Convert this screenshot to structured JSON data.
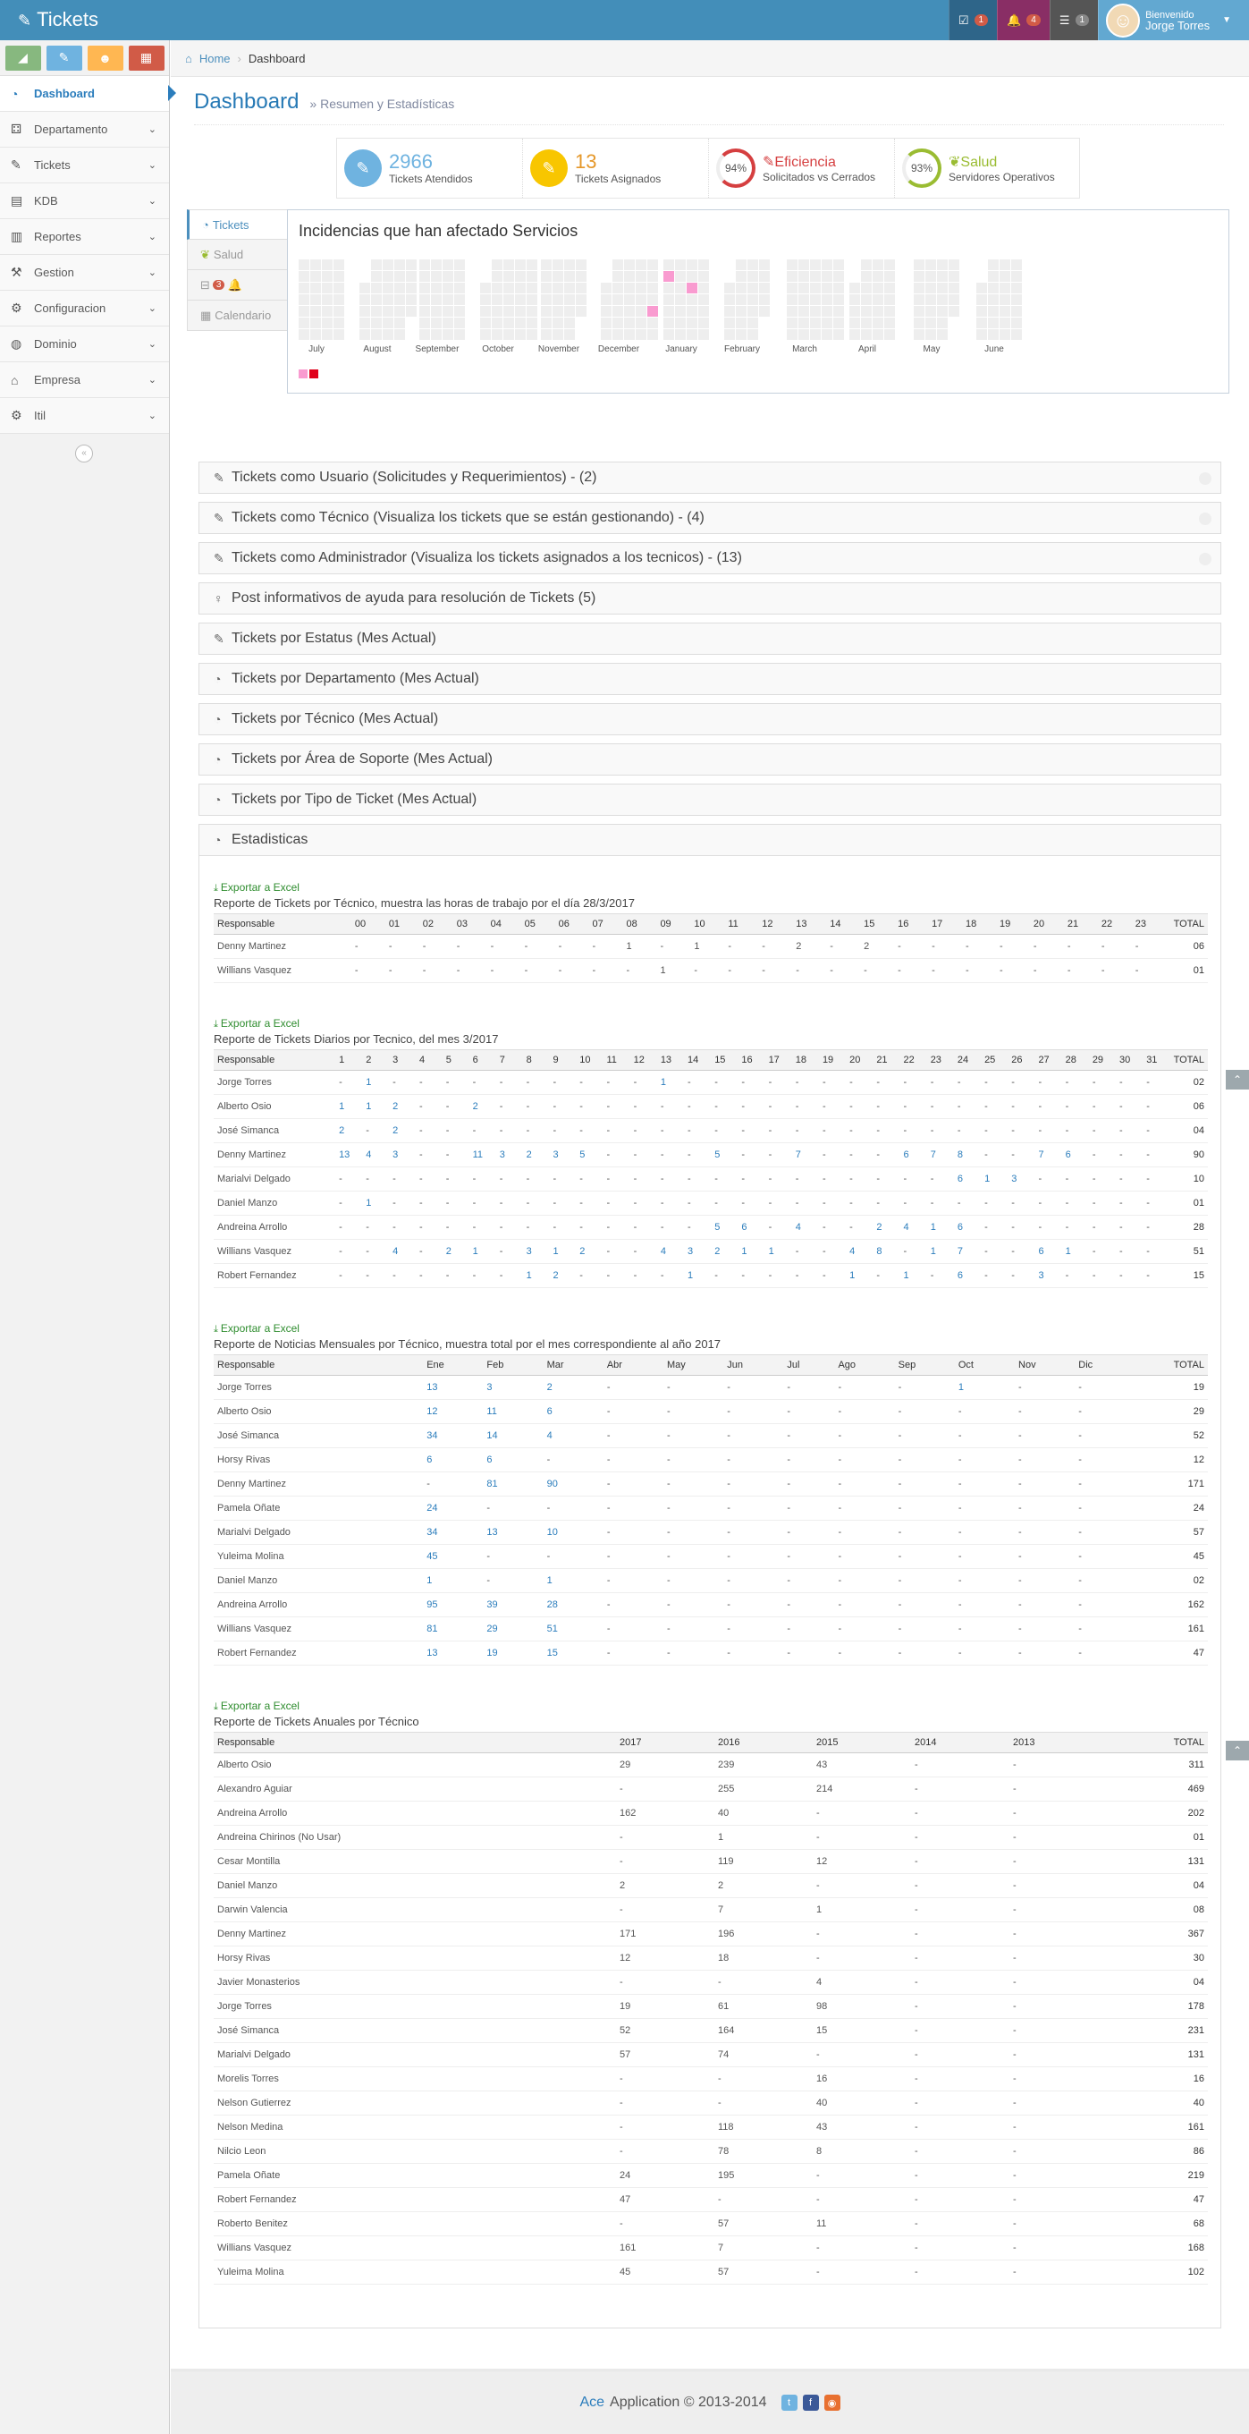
{
  "app": {
    "title": "Tickets"
  },
  "navbar": {
    "b1": "1",
    "b2": "4",
    "b3": "1",
    "welcome": "Bienvenido",
    "user": "Jorge Torres"
  },
  "sidebar": {
    "items": [
      {
        "label": "Dashboard",
        "icon": "dashboard-icon",
        "active": true
      },
      {
        "label": "Departamento",
        "icon": "sitemap-icon"
      },
      {
        "label": "Tickets",
        "icon": "ticket-icon"
      },
      {
        "label": "KDB",
        "icon": "book-icon"
      },
      {
        "label": "Reportes",
        "icon": "bar-chart-icon"
      },
      {
        "label": "Gestion",
        "icon": "wrench-icon"
      },
      {
        "label": "Configuracion",
        "icon": "cogs-icon"
      },
      {
        "label": "Dominio",
        "icon": "globe-icon"
      },
      {
        "label": "Empresa",
        "icon": "bank-icon"
      },
      {
        "label": "Itil",
        "icon": "gears-icon"
      }
    ]
  },
  "breadcrumb": {
    "home": "Home",
    "current": "Dashboard"
  },
  "header": {
    "title": "Dashboard",
    "subtitle": "» Resumen y Estadísticas"
  },
  "infoboxes": [
    {
      "num": "2966",
      "label": "Tickets Atendidos",
      "color": "#6fb3e0"
    },
    {
      "num": "13",
      "label": "Tickets Asignados",
      "color": "#f8c600"
    },
    {
      "pct": "94%",
      "title": "Eficiencia",
      "label": "Solicitados vs Cerrados",
      "color": "#d53f40"
    },
    {
      "pct": "93%",
      "title": "Salud",
      "label": "Servidores Operativos",
      "color": "#9abc32"
    }
  ],
  "tabs": {
    "t1": "Tickets",
    "t2": "Salud",
    "t3b": "3",
    "t4": "Calendario"
  },
  "heatmap": {
    "title": "Incidencias que han afectado Servicios",
    "months": [
      "July",
      "August",
      "September",
      "October",
      "November",
      "December",
      "January",
      "February",
      "March",
      "April",
      "May",
      "June"
    ]
  },
  "panels": [
    "Tickets como Usuario (Solicitudes y Requerimientos) - (2)",
    "Tickets como Técnico (Visualiza los tickets que se están gestionando) - (4)",
    "Tickets como Administrador (Visualiza los tickets asignados a los tecnicos) - (13)",
    "Post informativos de ayuda para resolución de Tickets (5)",
    "Tickets por Estatus (Mes Actual)",
    "Tickets por Departamento (Mes Actual)",
    "Tickets por Técnico (Mes Actual)",
    "Tickets por Área de Soporte (Mes Actual)",
    "Tickets por Tipo de Ticket (Mes Actual)",
    "Estadisticas"
  ],
  "export": "Exportar a Excel",
  "r1": {
    "title": "Reporte de Tickets por Técnico, muestra las horas de trabajo por el día 28/3/2017",
    "cols": [
      "Responsable",
      "00",
      "01",
      "02",
      "03",
      "04",
      "05",
      "06",
      "07",
      "08",
      "09",
      "10",
      "11",
      "12",
      "13",
      "14",
      "15",
      "16",
      "17",
      "18",
      "19",
      "20",
      "21",
      "22",
      "23",
      "TOTAL"
    ],
    "rows": [
      [
        "Denny Martinez",
        "-",
        "-",
        "-",
        "-",
        "-",
        "-",
        "-",
        "-",
        "1",
        "-",
        "1",
        "-",
        "-",
        "2",
        "-",
        "2",
        "-",
        "-",
        "-",
        "-",
        "-",
        "-",
        "-",
        "-",
        "06"
      ],
      [
        "Willians Vasquez",
        "-",
        "-",
        "-",
        "-",
        "-",
        "-",
        "-",
        "-",
        "-",
        "1",
        "-",
        "-",
        "-",
        "-",
        "-",
        "-",
        "-",
        "-",
        "-",
        "-",
        "-",
        "-",
        "-",
        "-",
        "01"
      ]
    ]
  },
  "r2": {
    "title": "Reporte de Tickets Diarios por Tecnico, del mes 3/2017",
    "cols": [
      "Responsable",
      "1",
      "2",
      "3",
      "4",
      "5",
      "6",
      "7",
      "8",
      "9",
      "10",
      "11",
      "12",
      "13",
      "14",
      "15",
      "16",
      "17",
      "18",
      "19",
      "20",
      "21",
      "22",
      "23",
      "24",
      "25",
      "26",
      "27",
      "28",
      "29",
      "30",
      "31",
      "TOTAL"
    ],
    "rows": [
      [
        "Jorge Torres",
        "-",
        "1",
        "-",
        "-",
        "-",
        "-",
        "-",
        "-",
        "-",
        "-",
        "-",
        "-",
        "1",
        "-",
        "-",
        "-",
        "-",
        "-",
        "-",
        "-",
        "-",
        "-",
        "-",
        "-",
        "-",
        "-",
        "-",
        "-",
        "-",
        "-",
        "-",
        "02"
      ],
      [
        "Alberto Osio",
        "1",
        "1",
        "2",
        "-",
        "-",
        "2",
        "-",
        "-",
        "-",
        "-",
        "-",
        "-",
        "-",
        "-",
        "-",
        "-",
        "-",
        "-",
        "-",
        "-",
        "-",
        "-",
        "-",
        "-",
        "-",
        "-",
        "-",
        "-",
        "-",
        "-",
        "-",
        "06"
      ],
      [
        "José Simanca",
        "2",
        "-",
        "2",
        "-",
        "-",
        "-",
        "-",
        "-",
        "-",
        "-",
        "-",
        "-",
        "-",
        "-",
        "-",
        "-",
        "-",
        "-",
        "-",
        "-",
        "-",
        "-",
        "-",
        "-",
        "-",
        "-",
        "-",
        "-",
        "-",
        "-",
        "-",
        "04"
      ],
      [
        "Denny Martinez",
        "13",
        "4",
        "3",
        "-",
        "-",
        "11",
        "3",
        "2",
        "3",
        "5",
        "-",
        "-",
        "-",
        "-",
        "5",
        "-",
        "-",
        "7",
        "-",
        "-",
        "-",
        "6",
        "7",
        "8",
        "-",
        "-",
        "7",
        "6",
        "-",
        "-",
        "-",
        "90"
      ],
      [
        "Marialvi Delgado",
        "-",
        "-",
        "-",
        "-",
        "-",
        "-",
        "-",
        "-",
        "-",
        "-",
        "-",
        "-",
        "-",
        "-",
        "-",
        "-",
        "-",
        "-",
        "-",
        "-",
        "-",
        "-",
        "-",
        "6",
        "1",
        "3",
        "-",
        "-",
        "-",
        "-",
        "-",
        "10"
      ],
      [
        "Daniel Manzo",
        "-",
        "1",
        "-",
        "-",
        "-",
        "-",
        "-",
        "-",
        "-",
        "-",
        "-",
        "-",
        "-",
        "-",
        "-",
        "-",
        "-",
        "-",
        "-",
        "-",
        "-",
        "-",
        "-",
        "-",
        "-",
        "-",
        "-",
        "-",
        "-",
        "-",
        "-",
        "01"
      ],
      [
        "Andreina Arrollo",
        "-",
        "-",
        "-",
        "-",
        "-",
        "-",
        "-",
        "-",
        "-",
        "-",
        "-",
        "-",
        "-",
        "-",
        "5",
        "6",
        "-",
        "4",
        "-",
        "-",
        "2",
        "4",
        "1",
        "6",
        "-",
        "-",
        "-",
        "-",
        "-",
        "-",
        "-",
        "28"
      ],
      [
        "Willians Vasquez",
        "-",
        "-",
        "4",
        "-",
        "2",
        "1",
        "-",
        "3",
        "1",
        "2",
        "-",
        "-",
        "4",
        "3",
        "2",
        "1",
        "1",
        "-",
        "-",
        "4",
        "8",
        "-",
        "1",
        "7",
        "-",
        "-",
        "6",
        "1",
        "-",
        "-",
        "-",
        "51"
      ],
      [
        "Robert Fernandez",
        "-",
        "-",
        "-",
        "-",
        "-",
        "-",
        "-",
        "1",
        "2",
        "-",
        "-",
        "-",
        "-",
        "1",
        "-",
        "-",
        "-",
        "-",
        "-",
        "1",
        "-",
        "1",
        "-",
        "6",
        "-",
        "-",
        "3",
        "-",
        "-",
        "-",
        "-",
        "15"
      ]
    ]
  },
  "r3": {
    "title": "Reporte de Noticias Mensuales por Técnico, muestra total por el mes correspondiente al año 2017",
    "cols": [
      "Responsable",
      "Ene",
      "Feb",
      "Mar",
      "Abr",
      "May",
      "Jun",
      "Jul",
      "Ago",
      "Sep",
      "Oct",
      "Nov",
      "Dic",
      "TOTAL"
    ],
    "rows": [
      [
        "Jorge Torres",
        "13",
        "3",
        "2",
        "-",
        "-",
        "-",
        "-",
        "-",
        "-",
        "1",
        "-",
        "-",
        "19"
      ],
      [
        "Alberto Osio",
        "12",
        "11",
        "6",
        "-",
        "-",
        "-",
        "-",
        "-",
        "-",
        "-",
        "-",
        "-",
        "29"
      ],
      [
        "José Simanca",
        "34",
        "14",
        "4",
        "-",
        "-",
        "-",
        "-",
        "-",
        "-",
        "-",
        "-",
        "-",
        "52"
      ],
      [
        "Horsy Rivas",
        "6",
        "6",
        "-",
        "-",
        "-",
        "-",
        "-",
        "-",
        "-",
        "-",
        "-",
        "-",
        "12"
      ],
      [
        "Denny Martinez",
        "-",
        "81",
        "90",
        "-",
        "-",
        "-",
        "-",
        "-",
        "-",
        "-",
        "-",
        "-",
        "171"
      ],
      [
        "Pamela Oñate",
        "24",
        "-",
        "-",
        "-",
        "-",
        "-",
        "-",
        "-",
        "-",
        "-",
        "-",
        "-",
        "24"
      ],
      [
        "Marialvi Delgado",
        "34",
        "13",
        "10",
        "-",
        "-",
        "-",
        "-",
        "-",
        "-",
        "-",
        "-",
        "-",
        "57"
      ],
      [
        "Yuleima Molina",
        "45",
        "-",
        "-",
        "-",
        "-",
        "-",
        "-",
        "-",
        "-",
        "-",
        "-",
        "-",
        "45"
      ],
      [
        "Daniel Manzo",
        "1",
        "-",
        "1",
        "-",
        "-",
        "-",
        "-",
        "-",
        "-",
        "-",
        "-",
        "-",
        "02"
      ],
      [
        "Andreina Arrollo",
        "95",
        "39",
        "28",
        "-",
        "-",
        "-",
        "-",
        "-",
        "-",
        "-",
        "-",
        "-",
        "162"
      ],
      [
        "Willians Vasquez",
        "81",
        "29",
        "51",
        "-",
        "-",
        "-",
        "-",
        "-",
        "-",
        "-",
        "-",
        "-",
        "161"
      ],
      [
        "Robert Fernandez",
        "13",
        "19",
        "15",
        "-",
        "-",
        "-",
        "-",
        "-",
        "-",
        "-",
        "-",
        "-",
        "47"
      ]
    ]
  },
  "r4": {
    "title": "Reporte de Tickets Anuales por Técnico",
    "cols": [
      "Responsable",
      "2017",
      "2016",
      "2015",
      "2014",
      "2013",
      "TOTAL"
    ],
    "rows": [
      [
        "Alberto Osio",
        "29",
        "239",
        "43",
        "-",
        "-",
        "311"
      ],
      [
        "Alexandro Aguiar",
        "-",
        "255",
        "214",
        "-",
        "-",
        "469"
      ],
      [
        "Andreina Arrollo",
        "162",
        "40",
        "-",
        "-",
        "-",
        "202"
      ],
      [
        "Andreina Chirinos (No Usar)",
        "-",
        "1",
        "-",
        "-",
        "-",
        "01"
      ],
      [
        "Cesar Montilla",
        "-",
        "119",
        "12",
        "-",
        "-",
        "131"
      ],
      [
        "Daniel Manzo",
        "2",
        "2",
        "-",
        "-",
        "-",
        "04"
      ],
      [
        "Darwin Valencia",
        "-",
        "7",
        "1",
        "-",
        "-",
        "08"
      ],
      [
        "Denny Martinez",
        "171",
        "196",
        "-",
        "-",
        "-",
        "367"
      ],
      [
        "Horsy Rivas",
        "12",
        "18",
        "-",
        "-",
        "-",
        "30"
      ],
      [
        "Javier Monasterios",
        "-",
        "-",
        "4",
        "-",
        "-",
        "04"
      ],
      [
        "Jorge Torres",
        "19",
        "61",
        "98",
        "-",
        "-",
        "178"
      ],
      [
        "José Simanca",
        "52",
        "164",
        "15",
        "-",
        "-",
        "231"
      ],
      [
        "Marialvi Delgado",
        "57",
        "74",
        "-",
        "-",
        "-",
        "131"
      ],
      [
        "Morelis Torres",
        "-",
        "-",
        "16",
        "-",
        "-",
        "16"
      ],
      [
        "Nelson Gutierrez",
        "-",
        "-",
        "40",
        "-",
        "-",
        "40"
      ],
      [
        "Nelson Medina",
        "-",
        "118",
        "43",
        "-",
        "-",
        "161"
      ],
      [
        "Nilcio Leon",
        "-",
        "78",
        "8",
        "-",
        "-",
        "86"
      ],
      [
        "Pamela Oñate",
        "24",
        "195",
        "-",
        "-",
        "-",
        "219"
      ],
      [
        "Robert Fernandez",
        "47",
        "-",
        "-",
        "-",
        "-",
        "47"
      ],
      [
        "Roberto Benitez",
        "-",
        "57",
        "11",
        "-",
        "-",
        "68"
      ],
      [
        "Willians Vasquez",
        "161",
        "7",
        "-",
        "-",
        "-",
        "168"
      ],
      [
        "Yuleima Molina",
        "45",
        "57",
        "-",
        "-",
        "-",
        "102"
      ]
    ]
  },
  "footer": {
    "brand": "Ace",
    "text": "Application © 2013-2014"
  }
}
